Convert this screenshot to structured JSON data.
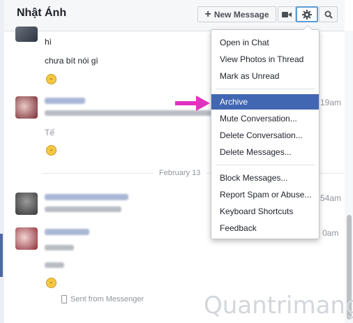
{
  "header": {
    "title": "Nhật Ánh",
    "new_message_label": "New Message"
  },
  "thread": {
    "messages_top": [
      "hì",
      "chưa bít nói gì"
    ],
    "blurred_word": "Tế",
    "date_separator": "February 13",
    "timestamps": [
      "19am",
      "54am",
      "0am"
    ],
    "sent_from": "Sent from Messenger"
  },
  "menu": {
    "items": [
      {
        "label": "Open in Chat",
        "active": false
      },
      {
        "label": "View Photos in Thread",
        "active": false
      },
      {
        "label": "Mark as Unread",
        "active": false
      },
      {
        "label": "Archive",
        "active": true
      },
      {
        "label": "Mute Conversation...",
        "active": false
      },
      {
        "label": "Delete Conversation...",
        "active": false
      },
      {
        "label": "Delete Messages...",
        "active": false
      },
      {
        "label": "Block Messages...",
        "active": false
      },
      {
        "label": "Report Spam or Abuse...",
        "active": false
      },
      {
        "label": "Keyboard Shortcuts",
        "active": false
      },
      {
        "label": "Feedback",
        "active": false
      }
    ]
  },
  "watermark": "Quantrimang",
  "icons": {
    "new_message": "plus-icon",
    "video": "video-camera-icon",
    "settings": "gear-icon",
    "search": "search-icon",
    "arrow": "arrow-right-icon"
  },
  "colors": {
    "menu_active": "#4267b2",
    "arrow": "#e033c0",
    "gear_highlight": "#5b9bd5"
  }
}
